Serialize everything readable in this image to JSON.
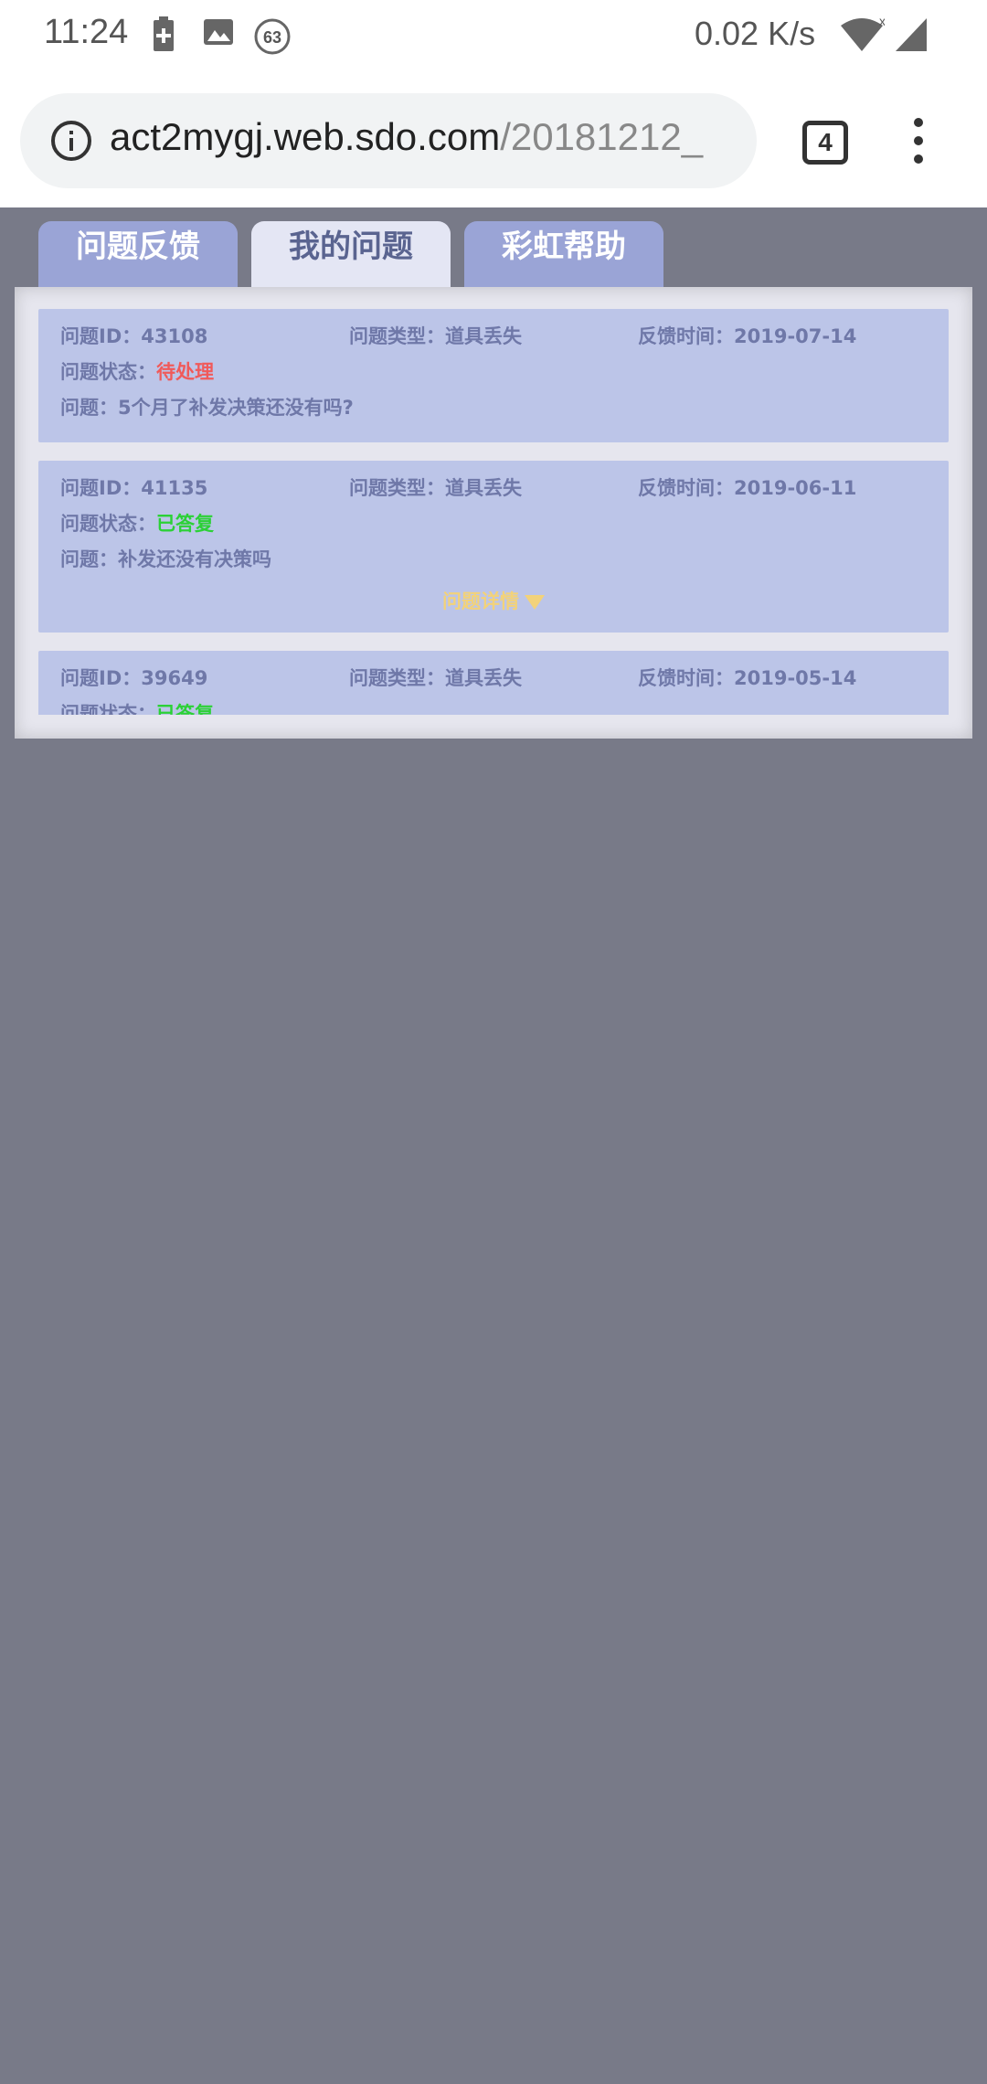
{
  "status_bar": {
    "time": "11:24",
    "counter": "63",
    "speed": "0.02 K/s",
    "icons": [
      "battery-charging-icon",
      "image-icon",
      "counter-icon",
      "wifi-icon",
      "signal-icon"
    ]
  },
  "browser": {
    "url_host": "act2mygj.web.sdo.com",
    "url_path": "/20181212_",
    "tab_count": "4"
  },
  "tabs": [
    {
      "label": "问题反馈",
      "active": false
    },
    {
      "label": "我的问题",
      "active": true
    },
    {
      "label": "彩虹帮助",
      "active": false
    }
  ],
  "issues": [
    {
      "id_text": "问题ID：43108",
      "type_text": "问题类型：道具丢失",
      "time_text": "反馈时间：2019-07-14",
      "status_label": "问题状态：",
      "status_value": "待处理",
      "question_text": "问题：5个月了补发决策还没有吗?"
    },
    {
      "id_text": "问题ID：41135",
      "type_text": "问题类型：道具丢失",
      "time_text": "反馈时间：2019-06-11",
      "status_label": "问题状态：",
      "status_value": "已答复",
      "question_text": "问题：补发还没有决策吗",
      "detail_label": "问题详情"
    },
    {
      "id_text": "问题ID：39649",
      "type_text": "问题类型：道具丢失",
      "time_text": "反馈时间：2019-05-14",
      "status_label": "问题状态：",
      "status_value": "已答复"
    }
  ],
  "colors": {
    "page_background": "#787a88",
    "tab_inactive": "#9aa4d6",
    "tab_active": "#e4e6f4",
    "card_background": "#bcc5e8",
    "status_pending": "#f05a5a",
    "status_answered": "#2bd136",
    "detail_link": "#f2d27a"
  }
}
